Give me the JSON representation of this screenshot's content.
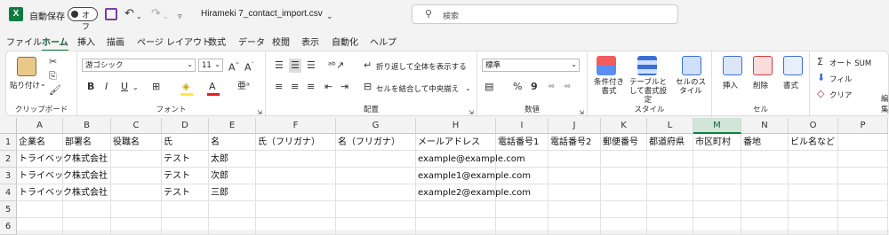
{
  "titlebar": {
    "app_icon": "X",
    "autosave_label": "自動保存",
    "autosave_state": "オフ",
    "filename": "Hirameki 7_contact_import.csv",
    "search_placeholder": "検索"
  },
  "menu": [
    "ファイル",
    "ホーム",
    "挿入",
    "描画",
    "ページ レイアウト",
    "数式",
    "データ",
    "校閲",
    "表示",
    "自動化",
    "ヘルプ"
  ],
  "ribbon": {
    "clipboard": {
      "paste": "貼り付け",
      "label": "クリップボード"
    },
    "font": {
      "name": "游ゴシック",
      "size": "11",
      "grow": "A^",
      "shrink": "Aˇ",
      "bold": "B",
      "italic": "I",
      "underline": "U",
      "label": "フォント"
    },
    "alignment": {
      "wrap": "折り返して全体を表示する",
      "merge": "セルを結合して中央揃え",
      "label": "配置"
    },
    "number": {
      "format": "標準",
      "label": "数値"
    },
    "styles": {
      "conditional": "条件付き書式",
      "table": "テーブルとして書式設定",
      "cell": "セルのスタイル",
      "label": "スタイル"
    },
    "cells": {
      "insert": "挿入",
      "delete": "削除",
      "format": "書式",
      "label": "セル"
    },
    "editing": {
      "autosum": "オート SUM",
      "fill": "フィル",
      "clear": "クリア",
      "label": "編集"
    }
  },
  "sheet": {
    "columns": [
      "A",
      "B",
      "C",
      "D",
      "E",
      "F",
      "G",
      "H",
      "I",
      "J",
      "K",
      "L",
      "M",
      "N",
      "O",
      "P"
    ],
    "rows": [
      "1",
      "2",
      "3",
      "4",
      "5",
      "6"
    ],
    "cells": [
      [
        "企業名",
        "部署名",
        "役職名",
        "氏",
        "名",
        "氏（フリガナ）",
        "名（フリガナ）",
        "メールアドレス",
        "電話番号1",
        "電話番号2",
        "郵便番号",
        "都道府県",
        "市区町村",
        "番地",
        "ビル名など",
        ""
      ],
      [
        "トライベック株式会社",
        "",
        "",
        "テスト",
        "太郎",
        "",
        "",
        "example@example.com",
        "",
        "",
        "",
        "",
        "",
        "",
        "",
        ""
      ],
      [
        "トライベック株式会社",
        "",
        "",
        "テスト",
        "次郎",
        "",
        "",
        "example1@example.com",
        "",
        "",
        "",
        "",
        "",
        "",
        "",
        ""
      ],
      [
        "トライベック株式会社",
        "",
        "",
        "テスト",
        "三郎",
        "",
        "",
        "example2@example.com",
        "",
        "",
        "",
        "",
        "",
        "",
        "",
        ""
      ],
      [
        "",
        "",
        "",
        "",
        "",
        "",
        "",
        "",
        "",
        "",
        "",
        "",
        "",
        "",
        "",
        ""
      ],
      [
        "",
        "",
        "",
        "",
        "",
        "",
        "",
        "",
        "",
        "",
        "",
        "",
        "",
        "",
        "",
        ""
      ]
    ],
    "selected_column": "M"
  }
}
